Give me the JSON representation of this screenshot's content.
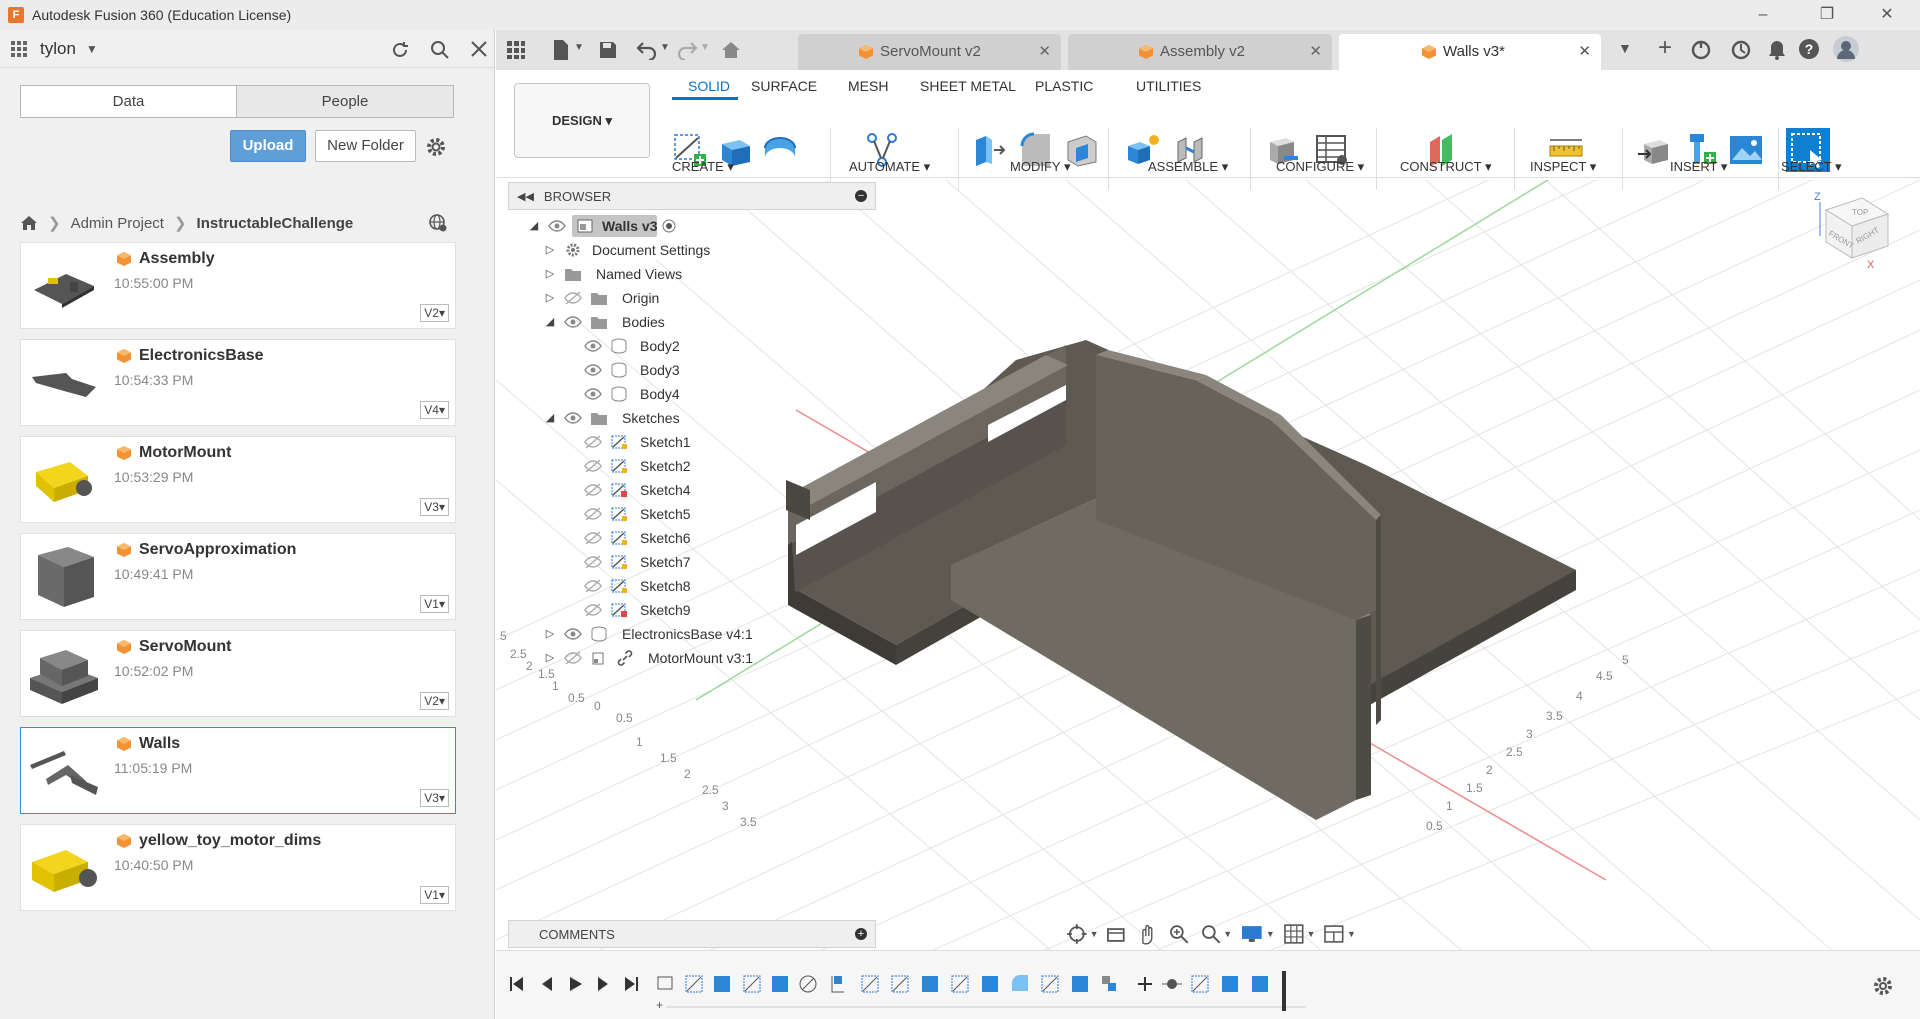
{
  "window": {
    "title": "Autodesk Fusion 360 (Education License)",
    "logo_letter": "F"
  },
  "left_panel": {
    "user": "tylon",
    "tabs": [
      "Data",
      "People"
    ],
    "upload_label": "Upload",
    "new_folder_label": "New Folder",
    "breadcrumb": [
      "Admin Project",
      "InstructableChallenge"
    ],
    "files": [
      {
        "name": "Assembly",
        "time": "10:55:00 PM",
        "version": "V2"
      },
      {
        "name": "ElectronicsBase",
        "time": "10:54:33 PM",
        "version": "V4"
      },
      {
        "name": "MotorMount",
        "time": "10:53:29 PM",
        "version": "V3"
      },
      {
        "name": "ServoApproximation",
        "time": "10:49:41 PM",
        "version": "V1"
      },
      {
        "name": "ServoMount",
        "time": "10:52:02 PM",
        "version": "V2"
      },
      {
        "name": "Walls",
        "time": "11:05:19 PM",
        "version": "V3"
      },
      {
        "name": "yellow_toy_motor_dims",
        "time": "10:40:50 PM",
        "version": "V1"
      }
    ]
  },
  "tabs": [
    {
      "label": "ServoMount v2"
    },
    {
      "label": "Assembly v2"
    },
    {
      "label": "Walls v3*"
    }
  ],
  "toolbar": {
    "workspace": "DESIGN",
    "tabs": [
      "SOLID",
      "SURFACE",
      "MESH",
      "SHEET METAL",
      "PLASTIC",
      "UTILITIES"
    ],
    "groups": [
      "CREATE",
      "AUTOMATE",
      "MODIFY",
      "ASSEMBLE",
      "CONFIGURE",
      "CONSTRUCT",
      "INSPECT",
      "INSERT",
      "SELECT"
    ]
  },
  "browser": {
    "title": "BROWSER",
    "root": "Walls v3",
    "items": [
      {
        "label": "Document Settings"
      },
      {
        "label": "Named Views"
      },
      {
        "label": "Origin"
      },
      {
        "label": "Bodies"
      },
      {
        "label": "Body2"
      },
      {
        "label": "Body3"
      },
      {
        "label": "Body4"
      },
      {
        "label": "Sketches"
      },
      {
        "label": "Sketch1"
      },
      {
        "label": "Sketch2"
      },
      {
        "label": "Sketch4"
      },
      {
        "label": "Sketch5"
      },
      {
        "label": "Sketch6"
      },
      {
        "label": "Sketch7"
      },
      {
        "label": "Sketch8"
      },
      {
        "label": "Sketch9"
      },
      {
        "label": "ElectronicsBase v4:1"
      },
      {
        "label": "MotorMount v3:1"
      }
    ]
  },
  "comments": {
    "title": "COMMENTS"
  },
  "viewcube": {
    "top": "TOP",
    "front": "FRONT",
    "right": "RIGHT",
    "z": "Z",
    "x": "X"
  },
  "grid_labels": {
    "left": [
      "5",
      "2.5",
      "2",
      "1.5",
      "1",
      "0.5",
      "0",
      "0.5",
      "1",
      "1.5",
      "2",
      "2.5",
      "3",
      "3.5"
    ],
    "bottom": [
      "0.5",
      "1",
      "1.5",
      "2",
      "2.5",
      "3",
      "3.5",
      "4",
      "4.5",
      "5"
    ]
  }
}
